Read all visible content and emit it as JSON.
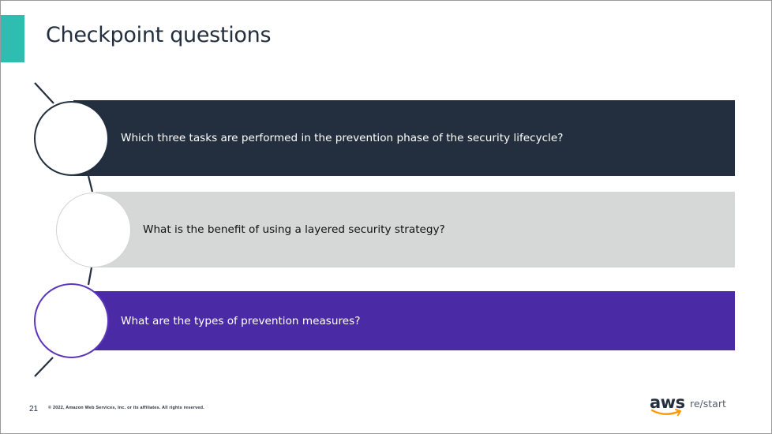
{
  "slide": {
    "title": "Checkpoint questions",
    "questions": [
      "Which three tasks are performed in the prevention phase of the security lifecycle?",
      "What is the benefit of using a layered security strategy?",
      "What are the types of prevention measures?"
    ],
    "page_number": "21",
    "copyright": "© 2022, Amazon Web Services, Inc. or its affiliates. All rights reserved.",
    "logo": {
      "brand": "aws",
      "product": "re/start"
    }
  },
  "colors": {
    "accent": "#2fbdb2",
    "dark_navy": "#232f3e",
    "light_gray": "#d5d8d6",
    "purple": "#4b2aa6",
    "aws_orange": "#ff9900"
  }
}
